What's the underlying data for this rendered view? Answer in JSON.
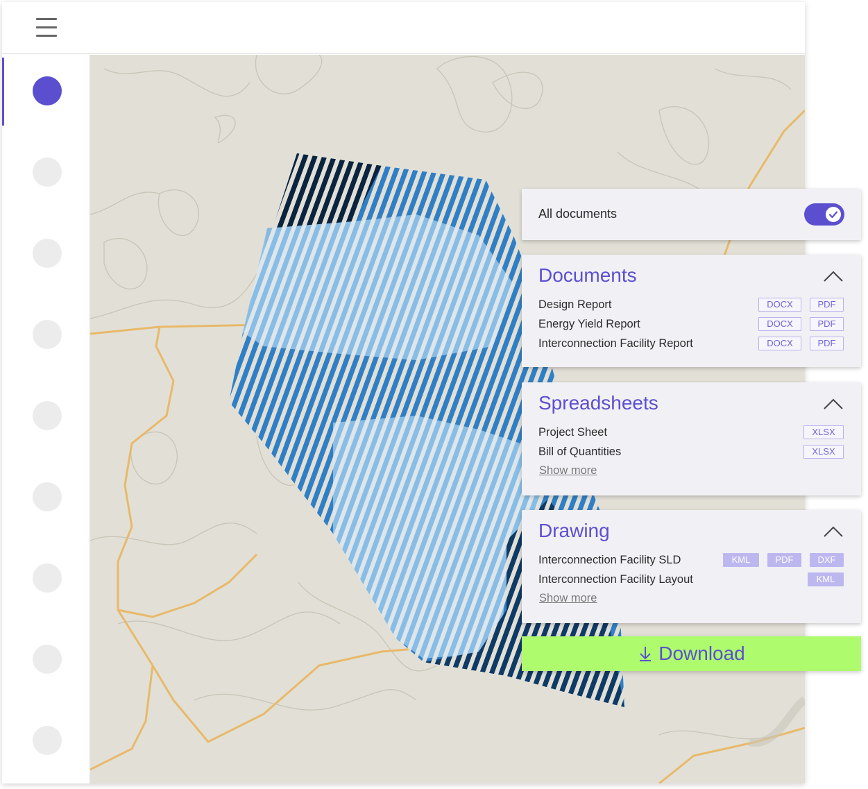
{
  "app": {
    "menu_icon": "hamburger-menu-icon",
    "accent_color": "#5b4fd0",
    "download_color": "#aefb6e"
  },
  "sidebar": {
    "items": [
      {
        "active": true
      },
      {
        "active": false
      },
      {
        "active": false
      },
      {
        "active": false
      },
      {
        "active": false
      },
      {
        "active": false
      },
      {
        "active": false
      },
      {
        "active": false
      },
      {
        "active": false
      }
    ]
  },
  "filter": {
    "all_documents_label": "All documents",
    "all_documents_enabled": true
  },
  "documents": {
    "title": "Documents",
    "items": [
      {
        "name": "Design Report",
        "formats": [
          "DOCX",
          "PDF"
        ]
      },
      {
        "name": "Energy Yield Report",
        "formats": [
          "DOCX",
          "PDF"
        ]
      },
      {
        "name": "Interconnection Facility Report",
        "formats": [
          "DOCX",
          "PDF"
        ]
      }
    ]
  },
  "spreadsheets": {
    "title": "Spreadsheets",
    "items": [
      {
        "name": "Project Sheet",
        "formats": [
          "XLSX"
        ]
      },
      {
        "name": "Bill of Quantities",
        "formats": [
          "XLSX"
        ]
      }
    ],
    "show_more": "Show more"
  },
  "drawing": {
    "title": "Drawing",
    "items": [
      {
        "name": "Interconnection Facility SLD",
        "formats": [
          "KML",
          "PDF",
          "DXF"
        ]
      },
      {
        "name": "Interconnection Facility Layout",
        "formats": [
          "KML"
        ]
      }
    ],
    "show_more": "Show more"
  },
  "download": {
    "label": "Download",
    "icon": "download-arrow-icon"
  }
}
